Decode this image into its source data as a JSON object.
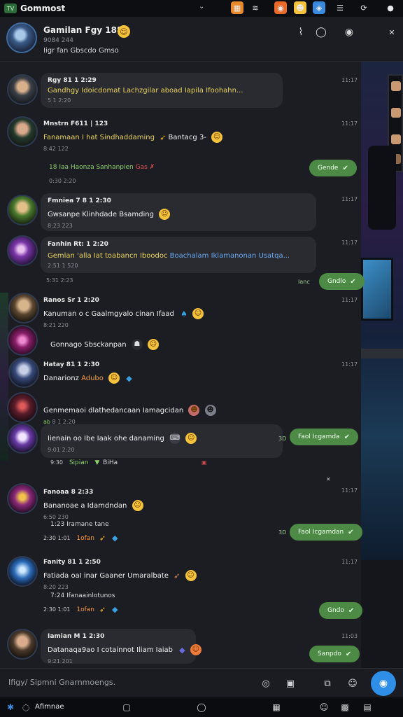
{
  "topbar": {
    "badge": "TV",
    "app_name": "Gommost",
    "dropdown": "⌄",
    "icons": [
      {
        "name": "calendar-icon",
        "glyph": "▦",
        "bg": "#e8892c"
      },
      {
        "name": "signal-icon",
        "glyph": "≋",
        "bg": "transparent"
      },
      {
        "name": "shield-icon",
        "glyph": "◉",
        "bg": "#ea6a2a"
      },
      {
        "name": "emoji-icon",
        "glyph": "☻",
        "bg": "#f5c23b"
      },
      {
        "name": "globe-icon",
        "glyph": "◈",
        "bg": "#3a8ae0"
      },
      {
        "name": "menu-icon",
        "glyph": "☰",
        "bg": "transparent"
      },
      {
        "name": "refresh-icon",
        "glyph": "⟳",
        "bg": "transparent"
      },
      {
        "name": "user-icon",
        "glyph": "●",
        "bg": "transparent"
      }
    ]
  },
  "header": {
    "title": "Gamilan Fgy 188",
    "sub1": "9084 244",
    "sub2": "Iigr fan Gbscdo Gmso",
    "emoji": "☺",
    "buttons": {
      "pin": "⌇",
      "search": "◯",
      "record": "◉",
      "close": "✕"
    }
  },
  "messages": [
    {
      "name": "Rgy 81 1 2:29",
      "text": "Gandhgy Idoicdomat Lachzgilar aboad Iapila Ifoohahn...",
      "meta": "5 1 2:20",
      "stamp": "11:17"
    },
    {
      "name": "Mnstrn F611 | 123",
      "text": "Fanamaan I hat Sindhaddaming",
      "text_b": "Bantacg 3-",
      "meta": "8:42 122",
      "stamp": "11:17",
      "sub": "18 Iaa Haonza Sanhanpien",
      "sub_b": "Gas ✗",
      "sub_meta": "0:30 2:20",
      "out": "Gende"
    },
    {
      "name": "Fmniea 7 8 1 2:30",
      "text": "Gwsanpe Klinhdade Bsamding",
      "meta": "8:23 223",
      "stamp": "11:17"
    },
    {
      "name": "Fanhin Rt: 1 2:20",
      "text_a": "Gemlan 'alla Iat toabancn Iboodoc",
      "text_b": "Boachalam Iklamanonan Usatqa...",
      "meta": "2:51 1 520",
      "stamp": "11:17",
      "sub_meta": "5:31 2:23",
      "out_label": "Ianc",
      "out": "Gndlo"
    },
    {
      "name": "Ranos Sr 1 2:20",
      "text": "Kanuman o c Gaalmgyalo cinan Ifaad",
      "meta": "8:21 220",
      "stamp": "11:17"
    },
    {
      "name": "",
      "text": "Gonnago Sbsckanpan",
      "meta": "",
      "stamp": ""
    },
    {
      "name": "Hatay 81 1 2:30",
      "text": "Danarionz",
      "text_b": "Adubo",
      "meta": "",
      "stamp": "11:17"
    },
    {
      "name": "",
      "text": "Genmemaoi dlathedancaan Iamagcidan",
      "meta": "8 1 2:20",
      "stamp": "",
      "meta_label": "ab"
    },
    {
      "name": "",
      "text": "Iienain oo Ibe Iaak ohe danaming",
      "meta": "9:01 2:20",
      "stamp": "",
      "sub": "Sipian",
      "sub_b": "BiHa",
      "sub_meta": "9:30",
      "out_label": "3D",
      "out": "Faol Icgamda"
    },
    {
      "name": "Fanoaa 8 2:33",
      "text": "Bananoae a Idamdndan",
      "meta": "6:50 230",
      "stamp": "11:17",
      "sub": "1:23 Iramane tane",
      "sub_meta": "2:30 1:01",
      "sub_b": "1ofan",
      "out_label": "3D",
      "out": "Faol Icgamdan"
    },
    {
      "name": "Fanity 81 1 2:50",
      "text": "Fatiada oaI inar Gaaner Umaralbate",
      "meta": "8:20 223",
      "stamp": "11:17",
      "sub": "7:24 Ifanaainlotunos",
      "sub_meta": "2:30 1:01",
      "sub_b": "1ofan",
      "out": "Gndo"
    },
    {
      "name": "Iamian M 1 2:30",
      "text": "Datanaqa9ao I cotainnot Iliam Iaiab",
      "meta": "9:21 201",
      "stamp": "11:03",
      "out": "Sanpdo"
    }
  ],
  "input": {
    "placeholder": "Ifigy/ Sipmni Gnarnmoengs.",
    "icons": {
      "emoji": "◎",
      "sticker": "▣",
      "attach": "⧉",
      "smile": "☺",
      "send": "◉"
    }
  },
  "taskbar": {
    "label": "Afimnae",
    "icons": {
      "start": "✱",
      "app": "◌",
      "square": "▢",
      "circle": "◯",
      "grid": "▦",
      "smile": "☺",
      "apps": "▩",
      "chart": "▤"
    }
  }
}
